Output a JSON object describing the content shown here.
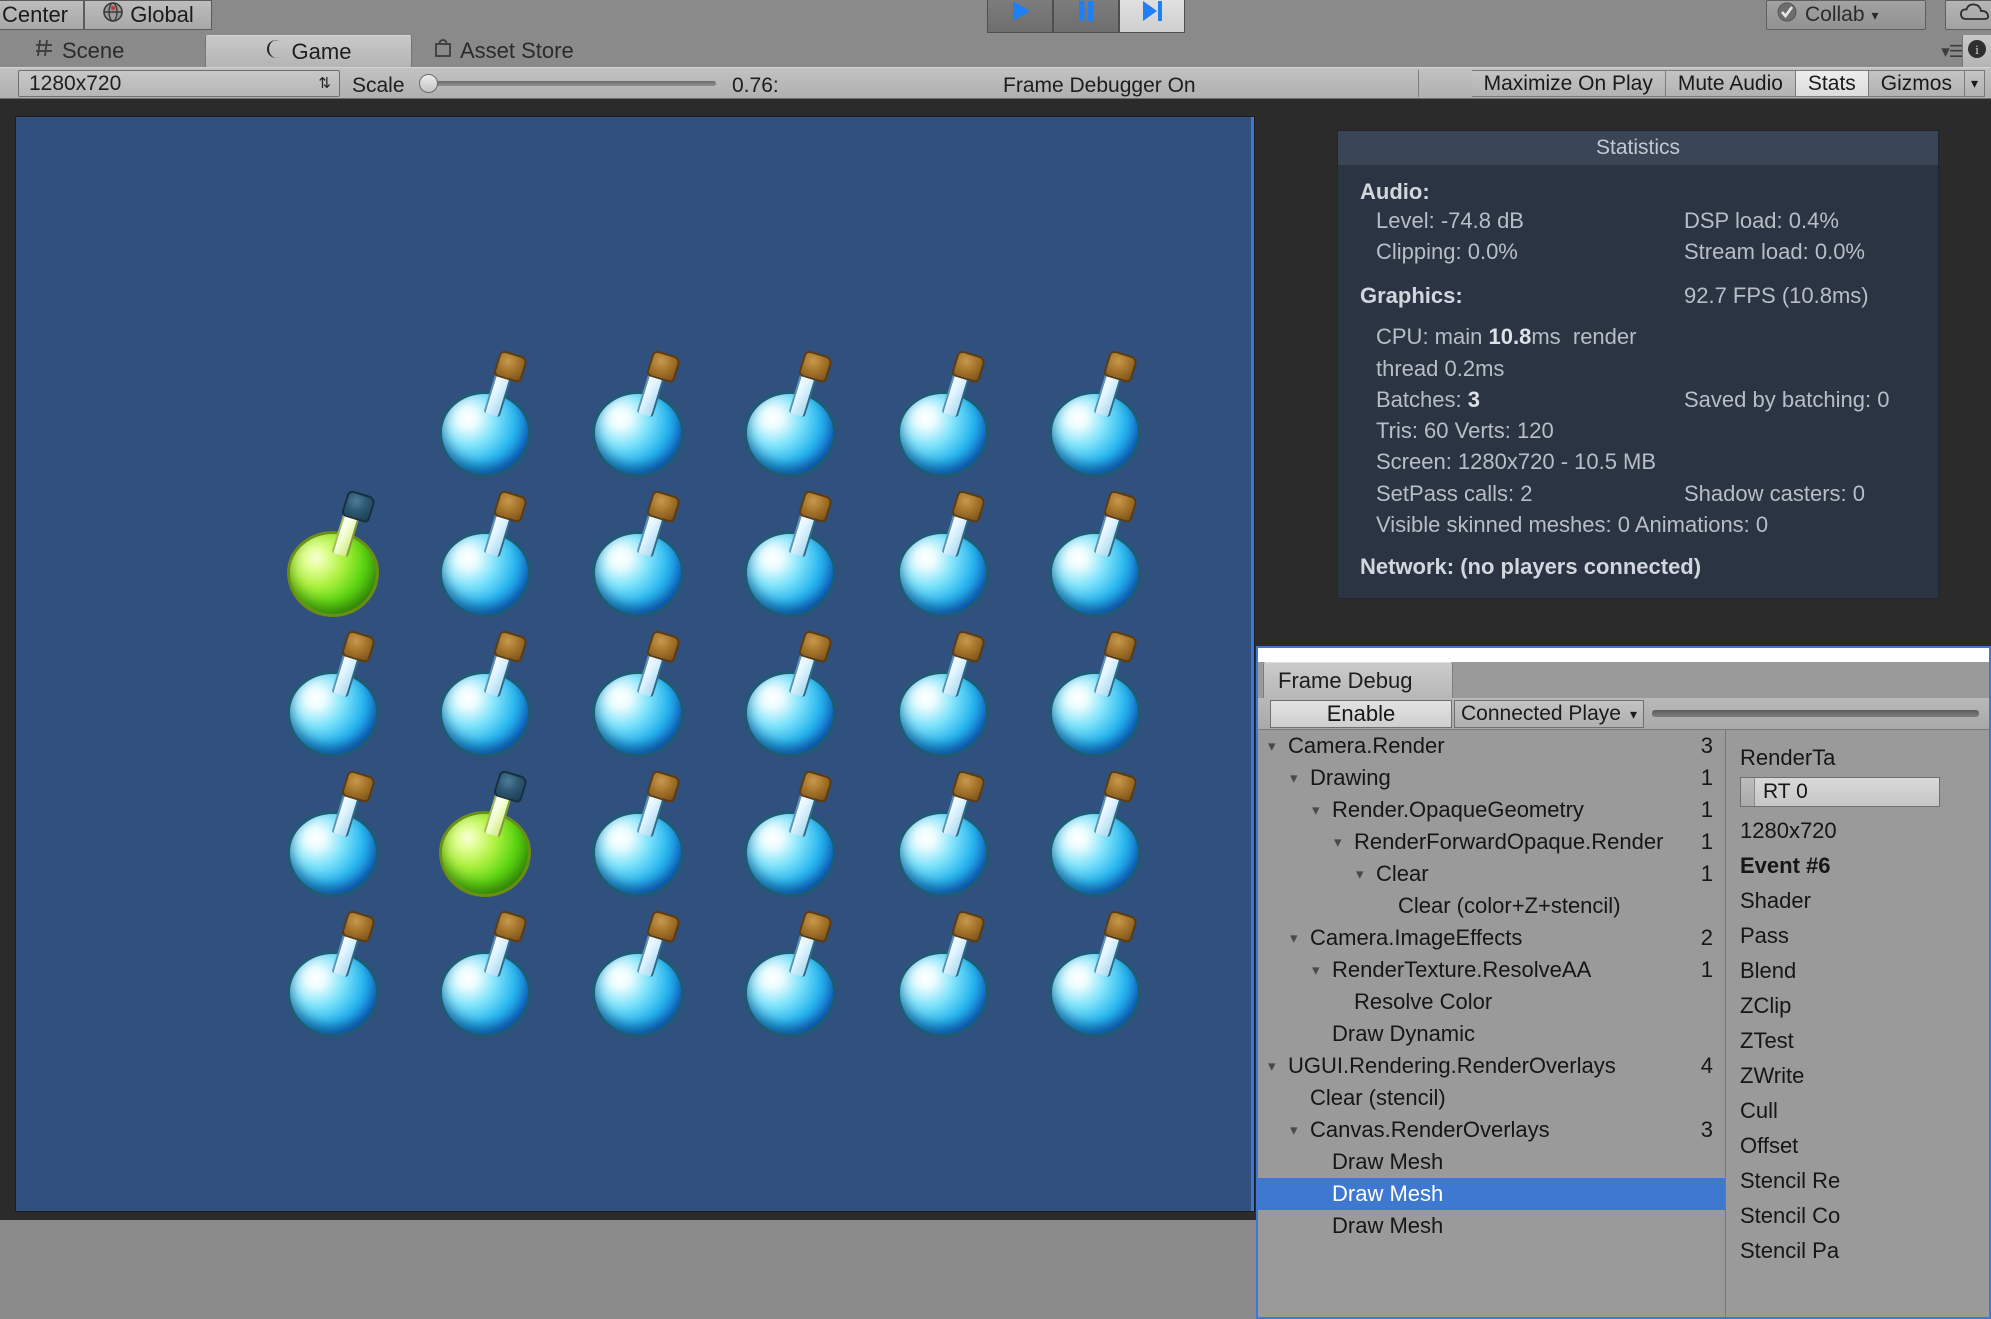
{
  "toolbar": {
    "pivot_rotation": "Center",
    "pivot_mode": "Global",
    "play_icon": "play-icon",
    "pause_icon": "pause-icon",
    "step_icon": "step-icon",
    "collab_label": "Collab",
    "collab_arrow": "▾",
    "cloud_icon": "cloud-icon"
  },
  "tabs": [
    {
      "label": "Scene",
      "icon": "grid-icon",
      "active": false
    },
    {
      "label": "Game",
      "icon": "gamepad-icon",
      "active": true
    },
    {
      "label": "Asset Store",
      "icon": "store-icon",
      "active": false
    }
  ],
  "game_toolbar": {
    "resolution": "1280x720",
    "resolution_arrows": "⇅",
    "scale_label": "Scale",
    "scale_value": "0.76:",
    "frame_debugger": "Frame Debugger On",
    "maximize_on_play": "Maximize On Play",
    "mute_audio": "Mute Audio",
    "stats": "Stats",
    "gizmos": "Gizmos",
    "gizmos_arrow": "▾"
  },
  "statistics": {
    "title": "Statistics",
    "audio_header": "Audio:",
    "audio": [
      {
        "left": "Level: -74.8 dB",
        "right": "DSP load: 0.4%"
      },
      {
        "left": "Clipping: 0.0%",
        "right": "Stream load: 0.0%"
      }
    ],
    "graphics_header": "Graphics:",
    "fps": "92.7 FPS (10.8ms)",
    "graphics": [
      {
        "left": "CPU: main ",
        "bold": "10.8",
        "left_tail": "ms  render thread 0.2ms",
        "right": ""
      },
      {
        "left": "Batches: ",
        "bold": "3",
        "left_tail": "",
        "right": "Saved by batching: 0"
      },
      {
        "left": "Tris: 60   Verts: 120",
        "bold": "",
        "left_tail": "",
        "right": ""
      },
      {
        "left": "Screen: 1280x720 - 10.5 MB",
        "bold": "",
        "left_tail": "",
        "right": ""
      },
      {
        "left": "SetPass calls: 2",
        "bold": "",
        "left_tail": "",
        "right": "Shadow casters: 0"
      },
      {
        "left": "Visible skinned meshes: 0  Animations: 0",
        "bold": "",
        "left_tail": "",
        "right": ""
      }
    ],
    "network": "Network: (no players connected)"
  },
  "frame_debug": {
    "tab_label": "Frame Debug",
    "enable_label": "Enable",
    "connected_player": "Connected Playe",
    "connected_arrow": "▾",
    "tree": [
      {
        "label": "Camera.Render",
        "count": "3",
        "depth": 0,
        "caret": "▾",
        "selected": false
      },
      {
        "label": "Drawing",
        "count": "1",
        "depth": 1,
        "caret": "▾",
        "selected": false
      },
      {
        "label": "Render.OpaqueGeometry",
        "count": "1",
        "depth": 2,
        "caret": "▾",
        "selected": false
      },
      {
        "label": "RenderForwardOpaque.Render",
        "count": "1",
        "depth": 3,
        "caret": "▾",
        "selected": false
      },
      {
        "label": "Clear",
        "count": "1",
        "depth": 4,
        "caret": "▾",
        "selected": false
      },
      {
        "label": "Clear (color+Z+stencil)",
        "count": "",
        "depth": 5,
        "caret": "",
        "selected": false
      },
      {
        "label": "Camera.ImageEffects",
        "count": "2",
        "depth": 1,
        "caret": "▾",
        "selected": false
      },
      {
        "label": "RenderTexture.ResolveAA",
        "count": "1",
        "depth": 2,
        "caret": "▾",
        "selected": false
      },
      {
        "label": "Resolve Color",
        "count": "",
        "depth": 3,
        "caret": "",
        "selected": false
      },
      {
        "label": "Draw Dynamic",
        "count": "",
        "depth": 2,
        "caret": "",
        "selected": false
      },
      {
        "label": "UGUI.Rendering.RenderOverlays",
        "count": "4",
        "depth": 0,
        "caret": "▾",
        "selected": false
      },
      {
        "label": "Clear (stencil)",
        "count": "",
        "depth": 1,
        "caret": "",
        "selected": false
      },
      {
        "label": "Canvas.RenderOverlays",
        "count": "3",
        "depth": 1,
        "caret": "▾",
        "selected": false
      },
      {
        "label": "Draw Mesh",
        "count": "",
        "depth": 2,
        "caret": "",
        "selected": false
      },
      {
        "label": "Draw Mesh",
        "count": "",
        "depth": 2,
        "caret": "",
        "selected": true
      },
      {
        "label": "Draw Mesh",
        "count": "",
        "depth": 2,
        "caret": "",
        "selected": false
      }
    ],
    "detail": {
      "render_target_label": "RenderTa",
      "rt_value": "RT 0",
      "rt_size": "1280x720",
      "event_label": "Event #6",
      "properties": [
        "Shader",
        "Pass",
        "Blend",
        "ZClip",
        "ZTest",
        "ZWrite",
        "Cull",
        "Offset",
        "Stencil Re",
        "Stencil Co",
        "Stencil Pa"
      ]
    }
  },
  "game_scene": {
    "background_color": "#30517e",
    "potion_color_blue": "#29b6ef",
    "potion_color_green": "#5ed613",
    "grid_columns": 6,
    "grid_rows": 5,
    "green_potion_positions": [
      {
        "row": 1,
        "col": 0
      },
      {
        "row": 3,
        "col": 1
      }
    ]
  }
}
